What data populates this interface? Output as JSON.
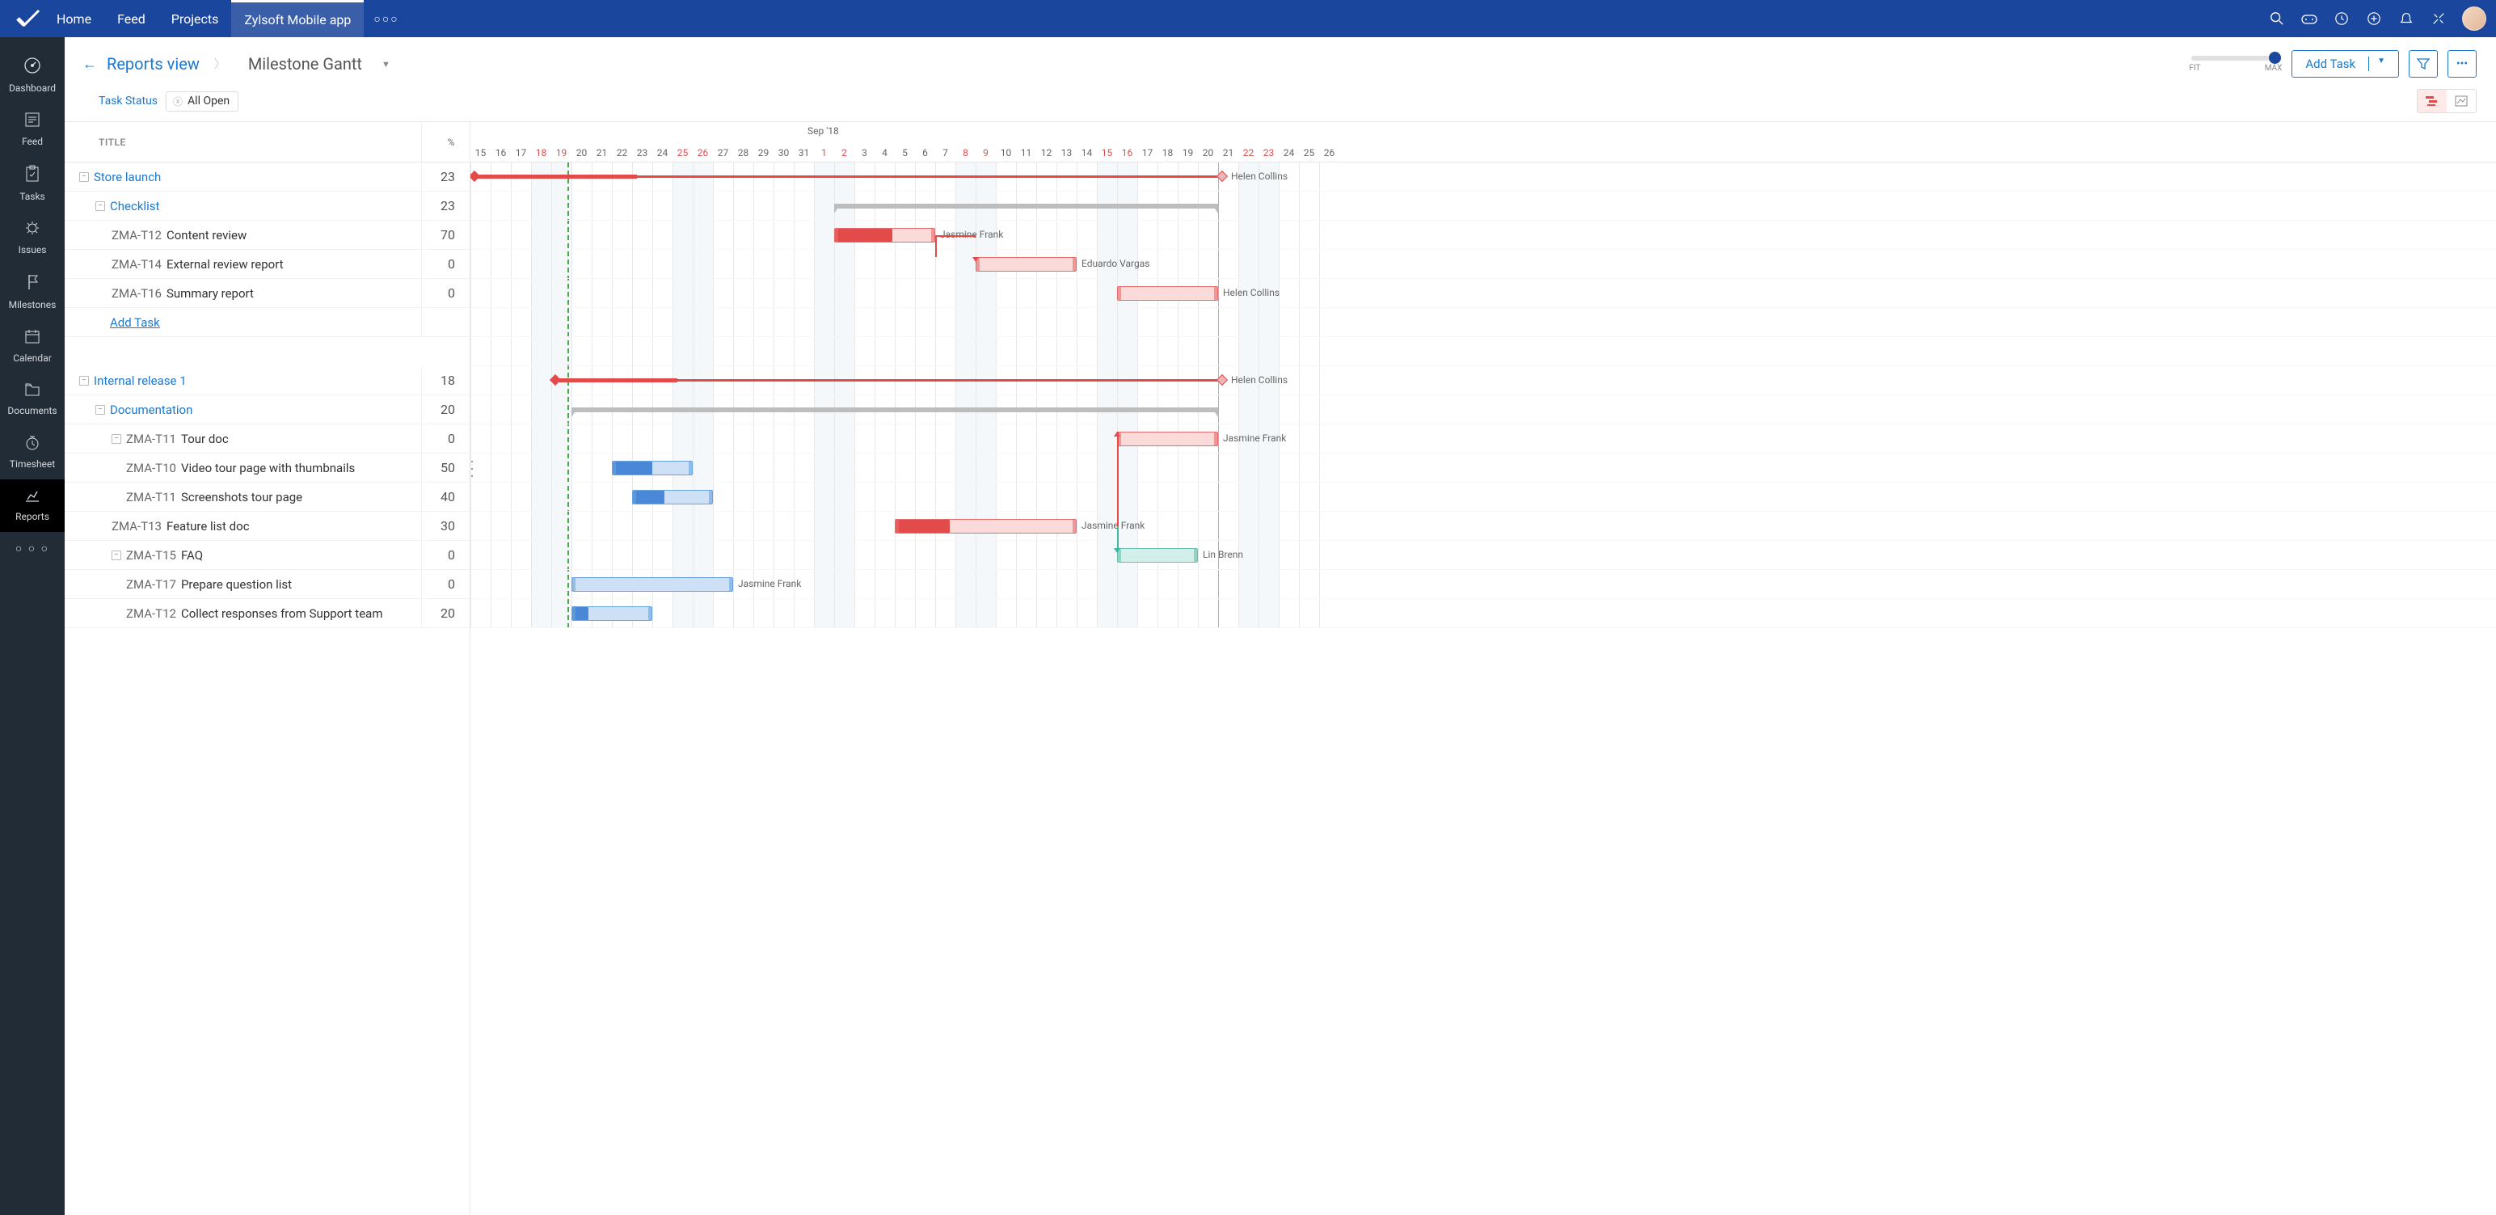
{
  "topnav": {
    "items": [
      "Home",
      "Feed",
      "Projects",
      "Zylsoft Mobile app"
    ],
    "activeIndex": 3
  },
  "sidebar": {
    "items": [
      "Dashboard",
      "Feed",
      "Tasks",
      "Issues",
      "Milestones",
      "Calendar",
      "Documents",
      "Timesheet",
      "Reports"
    ],
    "activeIndex": 8
  },
  "breadcrumb": {
    "parent": "Reports view",
    "current": "Milestone Gantt"
  },
  "toolbar": {
    "zoomMin": "FIT",
    "zoomMax": "MAX",
    "addTask": "Add Task"
  },
  "filter": {
    "label": "Task Status",
    "value": "All Open"
  },
  "columns": {
    "title": "TITLE",
    "percent": "%"
  },
  "timeline": {
    "month": "Sep '18",
    "days": [
      {
        "d": "15",
        "w": false
      },
      {
        "d": "16",
        "w": false
      },
      {
        "d": "17",
        "w": false
      },
      {
        "d": "18",
        "w": true
      },
      {
        "d": "19",
        "w": true
      },
      {
        "d": "20",
        "w": false
      },
      {
        "d": "21",
        "w": false
      },
      {
        "d": "22",
        "w": false
      },
      {
        "d": "23",
        "w": false
      },
      {
        "d": "24",
        "w": false
      },
      {
        "d": "25",
        "w": true
      },
      {
        "d": "26",
        "w": true
      },
      {
        "d": "27",
        "w": false
      },
      {
        "d": "28",
        "w": false
      },
      {
        "d": "29",
        "w": false
      },
      {
        "d": "30",
        "w": false
      },
      {
        "d": "31",
        "w": false
      },
      {
        "d": "1",
        "w": true
      },
      {
        "d": "2",
        "w": true
      },
      {
        "d": "3",
        "w": false
      },
      {
        "d": "4",
        "w": false
      },
      {
        "d": "5",
        "w": false
      },
      {
        "d": "6",
        "w": false
      },
      {
        "d": "7",
        "w": false
      },
      {
        "d": "8",
        "w": true
      },
      {
        "d": "9",
        "w": true
      },
      {
        "d": "10",
        "w": false
      },
      {
        "d": "11",
        "w": false
      },
      {
        "d": "12",
        "w": false
      },
      {
        "d": "13",
        "w": false
      },
      {
        "d": "14",
        "w": false
      },
      {
        "d": "15",
        "w": true
      },
      {
        "d": "16",
        "w": true
      },
      {
        "d": "17",
        "w": false
      },
      {
        "d": "18",
        "w": false
      },
      {
        "d": "19",
        "w": false
      },
      {
        "d": "20",
        "w": false
      },
      {
        "d": "21",
        "w": false
      },
      {
        "d": "22",
        "w": true
      },
      {
        "d": "23",
        "w": true
      },
      {
        "d": "24",
        "w": false
      },
      {
        "d": "25",
        "w": false
      },
      {
        "d": "26",
        "w": false
      }
    ],
    "monthStartIndex": 17
  },
  "rows": [
    {
      "type": "milestone",
      "indent": 0,
      "label": "Store launch",
      "pct": "23",
      "barStart": 0,
      "barEnd": 37,
      "doneEnd": 8,
      "assignee": "Helen Collins"
    },
    {
      "type": "summary",
      "indent": 1,
      "label": "Checklist",
      "pct": "23",
      "barStart": 18,
      "barEnd": 37
    },
    {
      "type": "task",
      "indent": 2,
      "id": "ZMA-T12",
      "name": "Content review",
      "pct": "70",
      "color": "red",
      "barStart": 18,
      "barLen": 5,
      "fillPct": 58,
      "assignee": "Jasmine Frank"
    },
    {
      "type": "task",
      "indent": 2,
      "id": "ZMA-T14",
      "name": "External review report",
      "pct": "0",
      "color": "red",
      "barStart": 25,
      "barLen": 5,
      "fillPct": 0,
      "assignee": "Eduardo Vargas"
    },
    {
      "type": "task",
      "indent": 2,
      "id": "ZMA-T16",
      "name": "Summary report",
      "pct": "0",
      "color": "red",
      "barStart": 32,
      "barLen": 5,
      "fillPct": 0,
      "assignee": "Helen Collins"
    },
    {
      "type": "addtask",
      "label": "Add Task"
    },
    {
      "type": "spacer"
    },
    {
      "type": "milestone",
      "indent": 0,
      "label": "Internal release 1",
      "pct": "18",
      "barStart": 4,
      "barEnd": 37,
      "doneEnd": 10,
      "assignee": "Helen Collins"
    },
    {
      "type": "summary",
      "indent": 1,
      "label": "Documentation",
      "pct": "20",
      "barStart": 5,
      "barEnd": 37
    },
    {
      "type": "task",
      "indent": 2,
      "id": "ZMA-T11",
      "name": "Tour doc",
      "pct": "0",
      "toggle": true,
      "color": "red",
      "barStart": 32,
      "barLen": 5,
      "fillPct": 0,
      "assignee": "Jasmine Frank"
    },
    {
      "type": "task",
      "indent": 3,
      "id": "ZMA-T10",
      "name": "Video tour page with thumbnails",
      "pct": "50",
      "color": "blue",
      "barStart": 7,
      "barLen": 4,
      "fillPct": 50
    },
    {
      "type": "task",
      "indent": 3,
      "id": "ZMA-T11",
      "name": "Screenshots tour page",
      "pct": "40",
      "color": "blue",
      "barStart": 8,
      "barLen": 4,
      "fillPct": 40
    },
    {
      "type": "task",
      "indent": 2,
      "id": "ZMA-T13",
      "name": "Feature list doc",
      "pct": "30",
      "color": "red",
      "barStart": 21,
      "barLen": 9,
      "fillPct": 30,
      "assignee": "Jasmine Frank"
    },
    {
      "type": "task",
      "indent": 2,
      "id": "ZMA-T15",
      "name": "FAQ",
      "pct": "0",
      "toggle": true,
      "color": "teal",
      "barStart": 32,
      "barLen": 4,
      "fillPct": 0,
      "assignee": "Lin Brenn"
    },
    {
      "type": "task",
      "indent": 3,
      "id": "ZMA-T17",
      "name": "Prepare question list",
      "pct": "0",
      "color": "blue",
      "barStart": 5,
      "barLen": 8,
      "fillPct": 0,
      "assignee": "Jasmine Frank"
    },
    {
      "type": "task",
      "indent": 3,
      "id": "ZMA-T12",
      "name": "Collect responses from Support team",
      "pct": "20",
      "color": "blue",
      "barStart": 5,
      "barLen": 4,
      "fillPct": 20
    }
  ],
  "deps": [
    {
      "fromRow": 2,
      "fromX": 23,
      "toRow": 3,
      "toX": 25,
      "color": "red"
    },
    {
      "fromRow": 12,
      "fromX": 32,
      "toRow": 9,
      "toX": 32,
      "color": "red",
      "up": true
    },
    {
      "fromRow": 12,
      "fromX": 32,
      "toRow": 13,
      "toX": 32,
      "color": "teal"
    }
  ]
}
